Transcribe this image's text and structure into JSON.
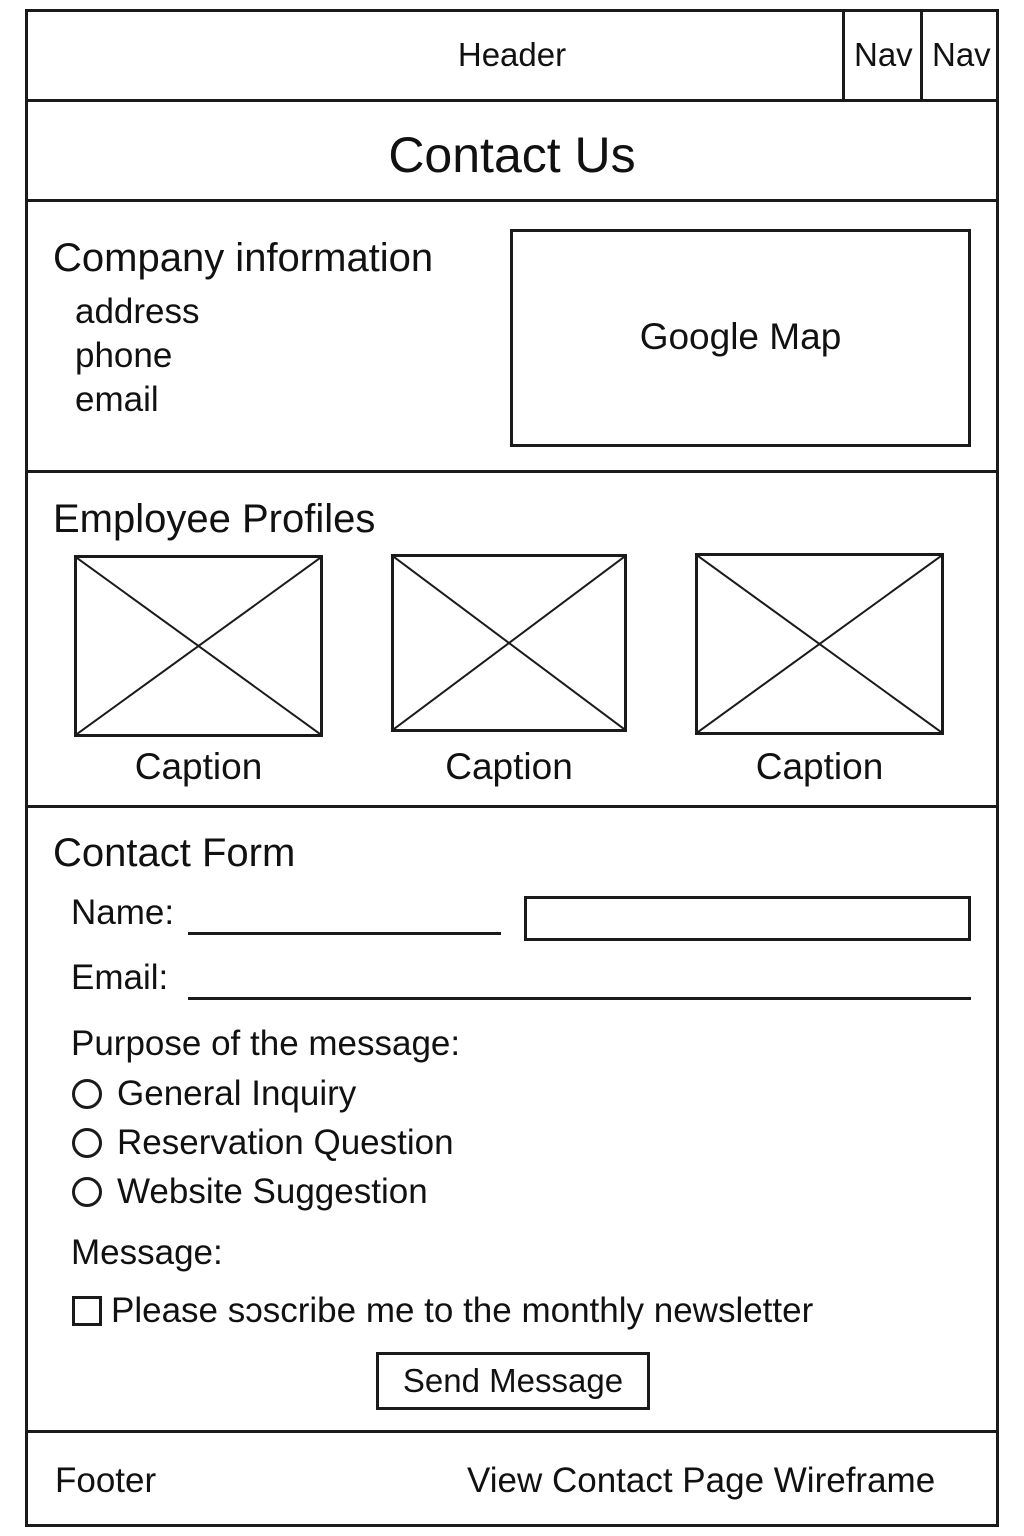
{
  "header": {
    "title": "Header",
    "nav_items": [
      "Nav",
      "Nav"
    ]
  },
  "page": {
    "title": "Contact Us"
  },
  "company_info": {
    "heading": "Company information",
    "lines": [
      "address",
      "phone",
      "email"
    ],
    "map_label": "Google Map"
  },
  "employees": {
    "heading": "Employee Profiles",
    "captions": [
      "Caption",
      "Caption",
      "Caption"
    ]
  },
  "contact_form": {
    "heading": "Contact Form",
    "name_label": "Name:",
    "name_value": "",
    "email_label": "Email:",
    "email_value": "",
    "purpose_label": "Purpose of the message:",
    "purpose_options": [
      "General Inquiry",
      "Reservation Question",
      "Website Suggestion"
    ],
    "message_label": "Message:",
    "newsletter_label": "Please sᴐscribe me to the monthly newsletter",
    "send_label": "Send Message"
  },
  "footer": {
    "left": "Footer",
    "right": "View Contact Page Wireframe"
  }
}
